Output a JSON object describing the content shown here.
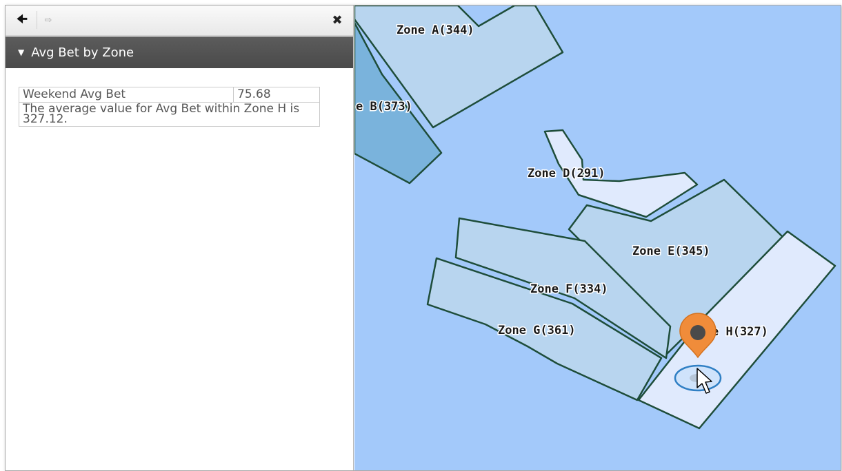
{
  "toolbar": {
    "back_icon": "left-arrow-icon",
    "forward_icon": "right-arrow-icon",
    "close_icon": "close-icon"
  },
  "panel": {
    "title": "Avg Bet by Zone",
    "table": {
      "row_label": "Weekend Avg Bet",
      "row_value": "75.68",
      "description": "The average value for Avg Bet within Zone H is 327.12."
    }
  },
  "map": {
    "background_color": "#a3c9fa",
    "zone_outline_color": "#1e4d3a",
    "pin_color": "#f08c3a",
    "zones": {
      "a": "Zone A(344)",
      "b": "e B(373)",
      "d": "Zone D(291)",
      "e": "Zone E(345)",
      "f": "Zone F(334)",
      "g": "Zone G(361)",
      "h": "e H(327)"
    }
  }
}
